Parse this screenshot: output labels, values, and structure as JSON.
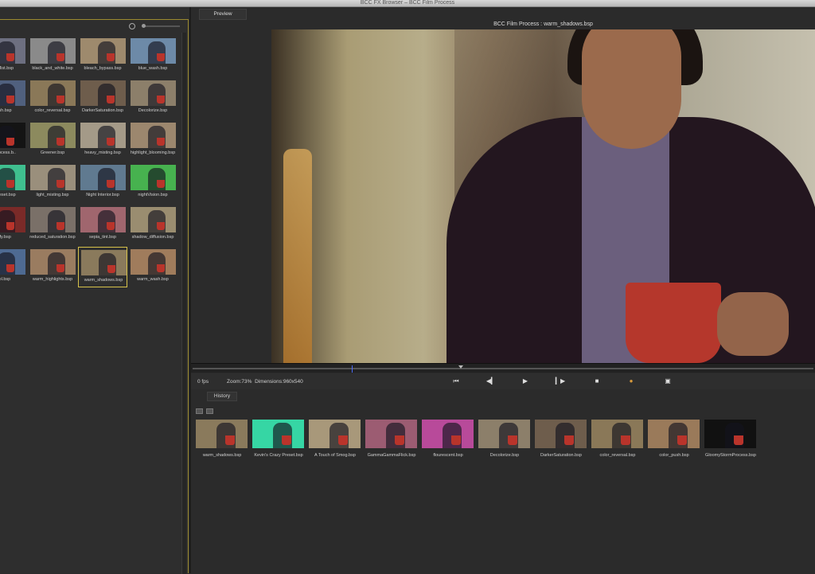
{
  "window": {
    "title": "BCC FX Browser – BCC Film Process"
  },
  "browser": {
    "presets": [
      {
        "label": "ge Mist.bsp",
        "color": "#6d6f80"
      },
      {
        "label": "black_and_white.bsp",
        "color": "#8a8a8a"
      },
      {
        "label": "bleach_bypass.bsp",
        "color": "#9e8a6d"
      },
      {
        "label": "blue_wash.bsp",
        "color": "#6d8aa8"
      },
      {
        "label": "wash.bsp",
        "color": "#50607e"
      },
      {
        "label": "color_reversal.bsp",
        "color": "#8a7858"
      },
      {
        "label": "DarkerSaturation.bsp",
        "color": "#6e5d4c"
      },
      {
        "label": "Decolorize.bsp",
        "color": "#8c7f6a"
      },
      {
        "label": "rmProcess.b..",
        "color": "#141414"
      },
      {
        "label": "Greener.bsp",
        "color": "#8c8a5e"
      },
      {
        "label": "heavy_misting.bsp",
        "color": "#a49a88"
      },
      {
        "label": "highlight_blooming.bsp",
        "color": "#9c876e"
      },
      {
        "label": "zy Preset.bsp",
        "color": "#3fbf8f"
      },
      {
        "label": "light_misting.bsp",
        "color": "#9a8f7c"
      },
      {
        "label": "Night Interior.bsp",
        "color": "#607a90"
      },
      {
        "label": "nightVision.bsp",
        "color": "#47b24f"
      },
      {
        "label": "onify.bsp",
        "color": "#7a2a28"
      },
      {
        "label": "reduced_saturation.bsp",
        "color": "#7a7068"
      },
      {
        "label": "sepia_tint.bsp",
        "color": "#a0666e"
      },
      {
        "label": "shadow_diffusion.bsp",
        "color": "#9a8d70"
      },
      {
        "label": "cool.bsp",
        "color": "#4e6a92"
      },
      {
        "label": "warm_highlights.bsp",
        "color": "#9a7c60"
      },
      {
        "label": "warm_shadows.bsp",
        "color": "#8a7a5c",
        "selected": true
      },
      {
        "label": "warm_wash.bsp",
        "color": "#a07c5c"
      }
    ]
  },
  "preview": {
    "tab_label": "Preview",
    "title": "BCC Film Process : warm_shadows.bsp",
    "fps": "0 fps",
    "zoom_label": "Zoom:73%",
    "dimensions_label": "Dimensions:960x540"
  },
  "controls": {
    "first": "⏮",
    "step_back": "◀▎",
    "play": "▶",
    "step_forward": "▎▶",
    "stop": "■",
    "color": "●",
    "snapshot": "▣"
  },
  "history": {
    "tab_label": "History",
    "items": [
      {
        "label": "warm_shadows.bsp",
        "color": "#8a7a5c"
      },
      {
        "label": "Kevin's Crazy Preset.bsp",
        "color": "#36d6a4"
      },
      {
        "label": "A Touch of Smog.bsp",
        "color": "#a8987a"
      },
      {
        "label": "GammaGammaFlick.bsp",
        "color": "#9c5c72"
      },
      {
        "label": "flourescent.bsp",
        "color": "#b84a9a"
      },
      {
        "label": "Decolorize.bsp",
        "color": "#8c7f6a"
      },
      {
        "label": "DarkerSaturation.bsp",
        "color": "#6e5d4c"
      },
      {
        "label": "color_reversal.bsp",
        "color": "#8a7858"
      },
      {
        "label": "color_push.bsp",
        "color": "#9a7a5a"
      },
      {
        "label": "GloomyStormProcess.bsp",
        "color": "#111111"
      }
    ]
  }
}
